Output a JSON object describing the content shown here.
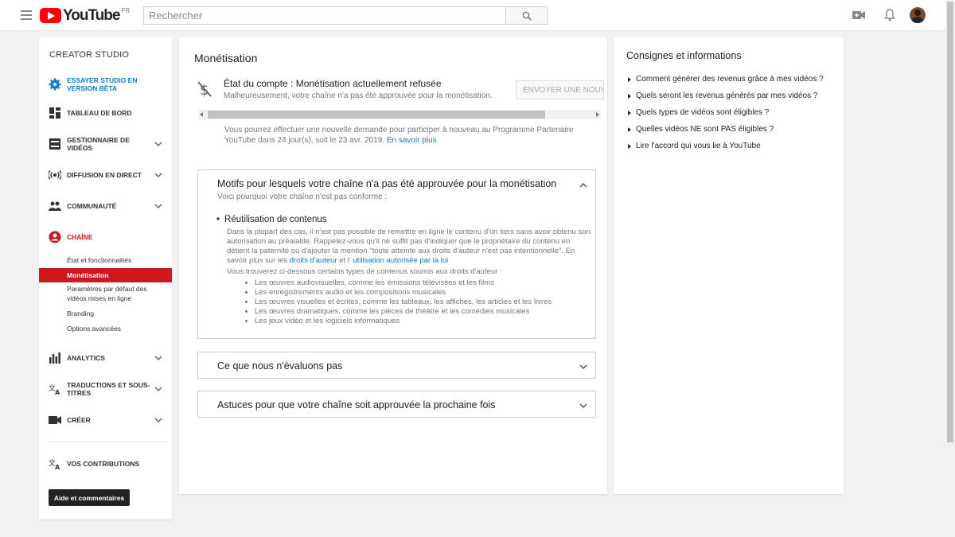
{
  "header": {
    "logo_text": "YouTube",
    "logo_country": "FR",
    "search_placeholder": "Rechercher"
  },
  "sidebar": {
    "title": "CREATOR STUDIO",
    "beta": "ESSAYER STUDIO EN VERSION BÊTA",
    "items": [
      {
        "label": "TABLEAU DE BORD",
        "icon": "dashboard-icon"
      },
      {
        "label": "GESTIONNAIRE DE VIDÉOS",
        "icon": "video-manager-icon"
      },
      {
        "label": "DIFFUSION EN DIRECT",
        "icon": "live-icon"
      },
      {
        "label": "COMMUNAUTÉ",
        "icon": "community-icon"
      },
      {
        "label": "CHAÎNE",
        "icon": "channel-icon"
      },
      {
        "label": "ANALYTICS",
        "icon": "analytics-icon"
      },
      {
        "label": "TRADUCTIONS ET SOUS-TITRES",
        "icon": "translate-icon"
      },
      {
        "label": "CRÉER",
        "icon": "create-icon"
      }
    ],
    "sub_items": [
      "État et fonctionnalités",
      "Monétisation",
      "Paramètres par défaut des vidéos mises en ligne",
      "Branding",
      "Options avancées"
    ],
    "contributions": "VOS CONTRIBUTIONS",
    "help_button": "Aide et commentaires",
    "accent_color": "#cc181e",
    "beta_color": "#167ac6"
  },
  "main": {
    "title": "Monétisation",
    "status_title": "État du compte : Monétisation actuellement refusée",
    "status_sub": "Malheureusement, votre chaîne n'a pas été approuvée pour la monétisation.",
    "send_button": "ENVOYER UNE NOUVE",
    "reapply_text": "Vous pourrez effectuer une nouvelle demande pour participer à nouveau au Programme Partenaire YouTube dans 24 jour(s), soit le 23 avr. 2019.",
    "reapply_link": "En savoir plus",
    "panel1": {
      "title": "Motifs pour lesquels votre chaîne n'a pas été approuvée pour la monétisation",
      "subtitle": "Voici pourquoi votre chaîne n'est pas conforme :",
      "bullet_title": "Réutilisation de contenus",
      "body": "Dans la plupart des cas, il n'est pas possible de remettre en ligne le contenu d'un tiers sans avoir obtenu son autorisation au préalable. Rappelez-vous qu'il ne suffit pas d'indiquer que le propriétaire du contenu en détient la paternité ou d'ajouter la mention \"toute atteinte aux droits d'auteur n'est pas intentionnelle\". En savoir plus sur les",
      "link1": "droits d'auteur",
      "and": "et l'",
      "link2": "utilisation autorisée par la loi",
      "intro": "Vous trouverez ci-dessous certains types de contenus soumis aux droits d'auteur :",
      "list": [
        "Les œuvres audiovisuelles, comme les émissions télévisées et les films",
        "Les enregistrements audio et les compositions musicales",
        "Les œuvres visuelles et écrites, comme les tableaux, les affiches, les articles et les livres",
        "Les œuvres dramatiques, comme les pièces de théâtre et les comédies musicales",
        "Les jeux vidéo et les logiciels informatiques"
      ]
    },
    "panel2_title": "Ce que nous n'évaluons pas",
    "panel3_title": "Astuces pour que votre chaîne soit approuvée la prochaine fois"
  },
  "right": {
    "title": "Consignes et informations",
    "links": [
      "Comment générer des revenus grâce à mes vidéos ?",
      "Quels seront les revenus générés par mes vidéos ?",
      "Quels types de vidéos sont éligibles ?",
      "Quelles vidéos NE sont PAS éligibles ?",
      "Lire l'accord qui vous lie à YouTube"
    ]
  }
}
